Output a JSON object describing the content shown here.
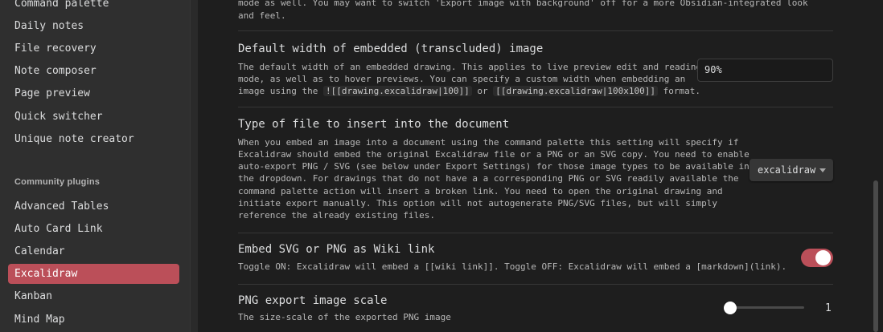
{
  "sidebar": {
    "core_items": [
      {
        "label": "Command palette"
      },
      {
        "label": "Daily notes"
      },
      {
        "label": "File recovery"
      },
      {
        "label": "Note composer"
      },
      {
        "label": "Page preview"
      },
      {
        "label": "Quick switcher"
      },
      {
        "label": "Unique note creator"
      }
    ],
    "community_heading": "Community plugins",
    "community_items": [
      {
        "label": "Advanced Tables"
      },
      {
        "label": "Auto Card Link"
      },
      {
        "label": "Calendar"
      },
      {
        "label": "Excalidraw",
        "active": true
      },
      {
        "label": "Kanban"
      },
      {
        "label": "Mind Map"
      }
    ]
  },
  "settings": {
    "intro": {
      "lines": [
        "mode as well. You may want to switch 'Export image with background' off for a more Obsidian-integrated look",
        "and feel."
      ]
    },
    "embed_width": {
      "name": "Default width of embedded (transcluded) image",
      "lines": [
        "The default width of an embedded drawing. This applies to live preview edit and reading",
        "mode, as well as to hover previews. You can specify a custom width when embedding an"
      ],
      "line3_prefix": "image using the ",
      "code1": "![[drawing.excalidraw|100]]",
      "line3_mid": " or ",
      "code2": "[[drawing.excalidraw|100x100]]",
      "line3_suffix": " format.",
      "value": "90%"
    },
    "file_type": {
      "name": "Type of file to insert into the document",
      "lines": [
        "When you embed an image into a document using the command palette this setting will specify if",
        "Excalidraw should embed the original Excalidraw file or a PNG or an SVG copy. You need to enable",
        "auto-export PNG / SVG (see below under Export Settings) for those image types to be available in",
        "the dropdown. For drawings that do not have a a corresponding PNG or SVG readily available the",
        "command palette action will insert a broken link. You need to open the original drawing and",
        "initiate export manually. This option will not autogenerate PNG/SVG files, but will simply",
        "reference the already existing files."
      ],
      "selected": "excalidraw"
    },
    "wiki_link": {
      "name": "Embed SVG or PNG as Wiki link",
      "desc": "Toggle ON: Excalidraw will embed a [[wiki link]]. Toggle OFF: Excalidraw will embed a [markdown](link).",
      "enabled": true
    },
    "png_scale": {
      "name": "PNG export image scale",
      "desc": "The size-scale of the exported PNG image",
      "value": "1"
    }
  },
  "colors": {
    "accent": "#bb4f59",
    "background": "#1e1e1e",
    "sidebar": "#2f2f2f"
  }
}
